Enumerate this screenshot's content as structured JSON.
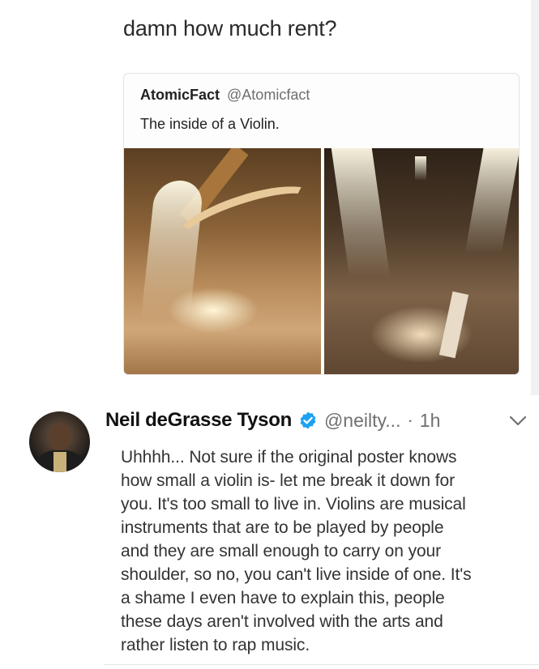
{
  "reply": {
    "text": "damn how much rent?"
  },
  "quoted_tweet": {
    "name": "AtomicFact",
    "handle": "@Atomicfact",
    "text": "The inside of a Violin."
  },
  "tweet": {
    "name": "Neil deGrasse Tyson",
    "handle": "@neilty...",
    "separator": "·",
    "time": "1h",
    "body_lines": [
      "Uhhhh... Not sure if the original poster knows",
      "how small a violin is- let me break it down for",
      "you. It's too small to live in. Violins are musical",
      "instruments that are to be played by people",
      "and they are small enough to carry on your",
      "shoulder, so no, you can't live inside of one. It's",
      "a shame I even have to explain this, people",
      "these days aren't involved with the arts and",
      "rather listen to rap music."
    ]
  },
  "icons": {
    "verified": "verified-badge-icon",
    "menu": "chevron-down-icon"
  },
  "colors": {
    "verified_blue": "#1da1f2",
    "handle_gray": "#707070"
  }
}
